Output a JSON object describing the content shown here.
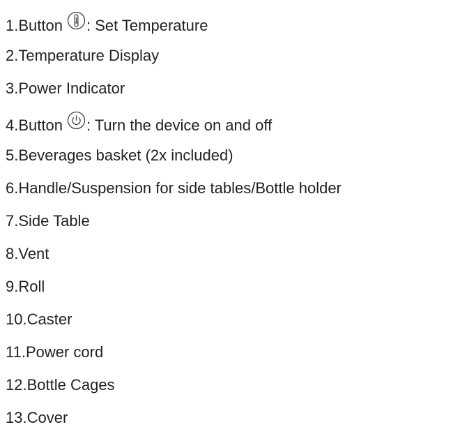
{
  "items": [
    {
      "number": "1.",
      "before": "Button",
      "icon": "thermometer-icon",
      "after": ": Set Temperature"
    },
    {
      "number": "2.",
      "before": "Temperature Display"
    },
    {
      "number": "3.",
      "before": "Power Indicator"
    },
    {
      "number": "4.",
      "before": "Button",
      "icon": "power-icon",
      "after": ": Turn the device on and off"
    },
    {
      "number": "5.",
      "before": "Beverages basket (2x included)"
    },
    {
      "number": "6.",
      "before": "Handle/Suspension for side tables/Bottle holder"
    },
    {
      "number": "7.",
      "before": "Side Table"
    },
    {
      "number": "8.",
      "before": "Vent"
    },
    {
      "number": "9.",
      "before": "Roll"
    },
    {
      "number": "10.",
      "before": "Caster"
    },
    {
      "number": "11.",
      "before": "Power cord"
    },
    {
      "number": "12.",
      "before": "Bottle Cages"
    },
    {
      "number": "13.",
      "before": "Cover"
    }
  ]
}
